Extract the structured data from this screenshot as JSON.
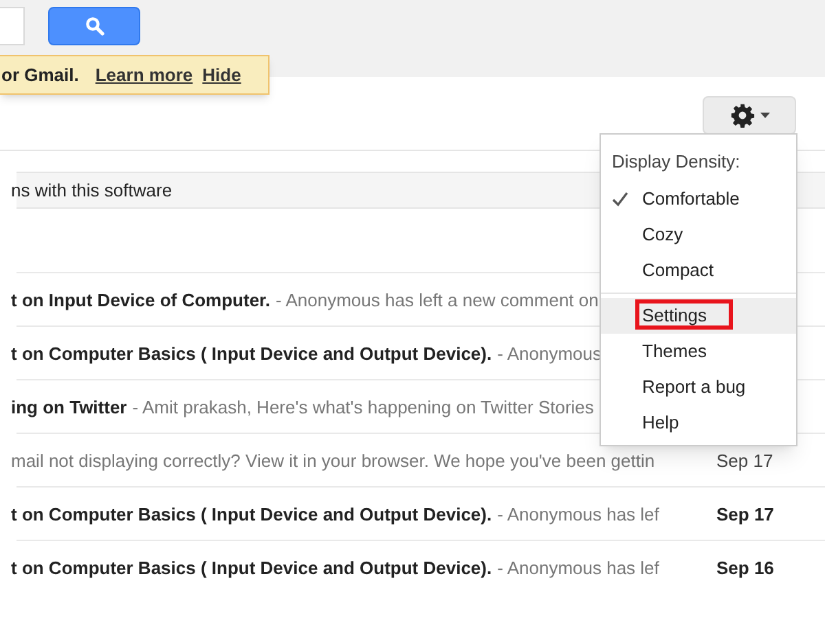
{
  "notice": {
    "text": "or Gmail.",
    "links": [
      "Learn more",
      "Hide"
    ]
  },
  "info_bar": {
    "text": "ns with this software"
  },
  "messages": [
    {
      "subject": "t on Input Device of Computer.",
      "snippet": "- Anonymous has left a new comment on",
      "unread": true
    },
    {
      "subject": "t on Computer Basics ( Input Device and Output Device).",
      "snippet": "- Anonymous",
      "unread": true
    },
    {
      "subject": "ing on Twitter",
      "snippet": "- Amit prakash, Here's what's happening on Twitter Stories",
      "unread": true
    },
    {
      "snippet": "mail not displaying correctly? View it in your browser. We hope you've been gettin",
      "date": "Sep 17",
      "unread": false
    },
    {
      "subject": "t on Computer Basics ( Input Device and Output Device).",
      "snippet": "- Anonymous has lef",
      "date": "Sep 17",
      "unread": true
    },
    {
      "subject": "t on Computer Basics ( Input Device and Output Device).",
      "snippet": "- Anonymous has lef",
      "date": "Sep 16",
      "unread": true
    }
  ],
  "settings_menu": {
    "heading": "Display Density:",
    "items": [
      {
        "kind": "density",
        "label": "Comfortable",
        "checked": true
      },
      {
        "kind": "density",
        "label": "Cozy",
        "checked": false
      },
      {
        "kind": "density",
        "label": "Compact",
        "checked": false
      },
      {
        "kind": "action",
        "label": "Settings",
        "highlighted": true
      },
      {
        "kind": "action",
        "label": "Themes",
        "highlighted": false
      },
      {
        "kind": "action",
        "label": "Report a bug",
        "highlighted": false
      },
      {
        "kind": "action",
        "label": "Help",
        "highlighted": false
      }
    ]
  }
}
